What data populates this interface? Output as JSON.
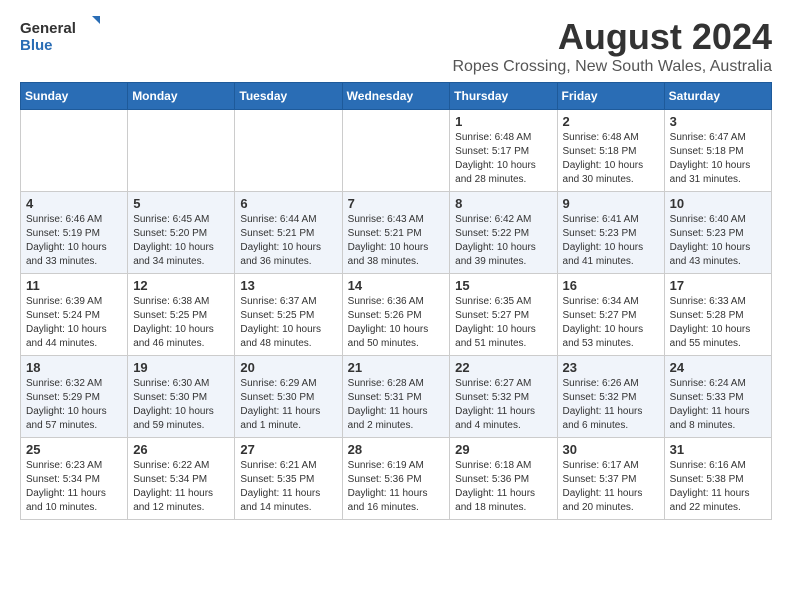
{
  "header": {
    "logo_general": "General",
    "logo_blue": "Blue",
    "month_year": "August 2024",
    "location": "Ropes Crossing, New South Wales, Australia"
  },
  "calendar": {
    "days_of_week": [
      "Sunday",
      "Monday",
      "Tuesday",
      "Wednesday",
      "Thursday",
      "Friday",
      "Saturday"
    ],
    "weeks": [
      [
        {
          "day": "",
          "info": ""
        },
        {
          "day": "",
          "info": ""
        },
        {
          "day": "",
          "info": ""
        },
        {
          "day": "",
          "info": ""
        },
        {
          "day": "1",
          "info": "Sunrise: 6:48 AM\nSunset: 5:17 PM\nDaylight: 10 hours\nand 28 minutes."
        },
        {
          "day": "2",
          "info": "Sunrise: 6:48 AM\nSunset: 5:18 PM\nDaylight: 10 hours\nand 30 minutes."
        },
        {
          "day": "3",
          "info": "Sunrise: 6:47 AM\nSunset: 5:18 PM\nDaylight: 10 hours\nand 31 minutes."
        }
      ],
      [
        {
          "day": "4",
          "info": "Sunrise: 6:46 AM\nSunset: 5:19 PM\nDaylight: 10 hours\nand 33 minutes."
        },
        {
          "day": "5",
          "info": "Sunrise: 6:45 AM\nSunset: 5:20 PM\nDaylight: 10 hours\nand 34 minutes."
        },
        {
          "day": "6",
          "info": "Sunrise: 6:44 AM\nSunset: 5:21 PM\nDaylight: 10 hours\nand 36 minutes."
        },
        {
          "day": "7",
          "info": "Sunrise: 6:43 AM\nSunset: 5:21 PM\nDaylight: 10 hours\nand 38 minutes."
        },
        {
          "day": "8",
          "info": "Sunrise: 6:42 AM\nSunset: 5:22 PM\nDaylight: 10 hours\nand 39 minutes."
        },
        {
          "day": "9",
          "info": "Sunrise: 6:41 AM\nSunset: 5:23 PM\nDaylight: 10 hours\nand 41 minutes."
        },
        {
          "day": "10",
          "info": "Sunrise: 6:40 AM\nSunset: 5:23 PM\nDaylight: 10 hours\nand 43 minutes."
        }
      ],
      [
        {
          "day": "11",
          "info": "Sunrise: 6:39 AM\nSunset: 5:24 PM\nDaylight: 10 hours\nand 44 minutes."
        },
        {
          "day": "12",
          "info": "Sunrise: 6:38 AM\nSunset: 5:25 PM\nDaylight: 10 hours\nand 46 minutes."
        },
        {
          "day": "13",
          "info": "Sunrise: 6:37 AM\nSunset: 5:25 PM\nDaylight: 10 hours\nand 48 minutes."
        },
        {
          "day": "14",
          "info": "Sunrise: 6:36 AM\nSunset: 5:26 PM\nDaylight: 10 hours\nand 50 minutes."
        },
        {
          "day": "15",
          "info": "Sunrise: 6:35 AM\nSunset: 5:27 PM\nDaylight: 10 hours\nand 51 minutes."
        },
        {
          "day": "16",
          "info": "Sunrise: 6:34 AM\nSunset: 5:27 PM\nDaylight: 10 hours\nand 53 minutes."
        },
        {
          "day": "17",
          "info": "Sunrise: 6:33 AM\nSunset: 5:28 PM\nDaylight: 10 hours\nand 55 minutes."
        }
      ],
      [
        {
          "day": "18",
          "info": "Sunrise: 6:32 AM\nSunset: 5:29 PM\nDaylight: 10 hours\nand 57 minutes."
        },
        {
          "day": "19",
          "info": "Sunrise: 6:30 AM\nSunset: 5:30 PM\nDaylight: 10 hours\nand 59 minutes."
        },
        {
          "day": "20",
          "info": "Sunrise: 6:29 AM\nSunset: 5:30 PM\nDaylight: 11 hours\nand 1 minute."
        },
        {
          "day": "21",
          "info": "Sunrise: 6:28 AM\nSunset: 5:31 PM\nDaylight: 11 hours\nand 2 minutes."
        },
        {
          "day": "22",
          "info": "Sunrise: 6:27 AM\nSunset: 5:32 PM\nDaylight: 11 hours\nand 4 minutes."
        },
        {
          "day": "23",
          "info": "Sunrise: 6:26 AM\nSunset: 5:32 PM\nDaylight: 11 hours\nand 6 minutes."
        },
        {
          "day": "24",
          "info": "Sunrise: 6:24 AM\nSunset: 5:33 PM\nDaylight: 11 hours\nand 8 minutes."
        }
      ],
      [
        {
          "day": "25",
          "info": "Sunrise: 6:23 AM\nSunset: 5:34 PM\nDaylight: 11 hours\nand 10 minutes."
        },
        {
          "day": "26",
          "info": "Sunrise: 6:22 AM\nSunset: 5:34 PM\nDaylight: 11 hours\nand 12 minutes."
        },
        {
          "day": "27",
          "info": "Sunrise: 6:21 AM\nSunset: 5:35 PM\nDaylight: 11 hours\nand 14 minutes."
        },
        {
          "day": "28",
          "info": "Sunrise: 6:19 AM\nSunset: 5:36 PM\nDaylight: 11 hours\nand 16 minutes."
        },
        {
          "day": "29",
          "info": "Sunrise: 6:18 AM\nSunset: 5:36 PM\nDaylight: 11 hours\nand 18 minutes."
        },
        {
          "day": "30",
          "info": "Sunrise: 6:17 AM\nSunset: 5:37 PM\nDaylight: 11 hours\nand 20 minutes."
        },
        {
          "day": "31",
          "info": "Sunrise: 6:16 AM\nSunset: 5:38 PM\nDaylight: 11 hours\nand 22 minutes."
        }
      ]
    ]
  }
}
